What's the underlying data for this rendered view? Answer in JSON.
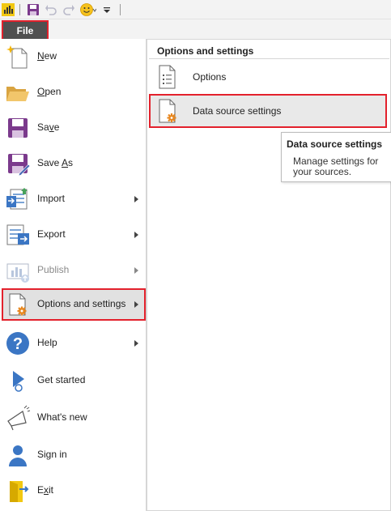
{
  "colors": {
    "highlight": "#e3212c",
    "file_tab": "#505050",
    "accent_orange": "#e8871e",
    "accent_purple": "#7b3a8c"
  },
  "toolbar": {
    "icons": [
      "power-bi-logo-icon",
      "save-icon",
      "undo-icon",
      "redo-icon",
      "smiley-feedback-icon",
      "customize-toolbar-icon"
    ]
  },
  "file_tab": {
    "label": "File"
  },
  "menu": {
    "items": [
      {
        "id": "new",
        "pre": "",
        "key": "N",
        "post": "ew",
        "icon": "new-file-icon",
        "has_submenu": false
      },
      {
        "id": "open",
        "pre": "",
        "key": "O",
        "post": "pen",
        "icon": "folder-open-icon",
        "has_submenu": false
      },
      {
        "id": "save",
        "pre": "Sa",
        "key": "v",
        "post": "e",
        "icon": "save-icon",
        "has_submenu": false
      },
      {
        "id": "save-as",
        "pre": "Save ",
        "key": "A",
        "post": "s",
        "icon": "save-as-icon",
        "has_submenu": false
      },
      {
        "id": "import",
        "label": "Import",
        "icon": "import-icon",
        "has_submenu": true
      },
      {
        "id": "export",
        "label": "Export",
        "icon": "export-icon",
        "has_submenu": true
      },
      {
        "id": "publish",
        "label": "Publish",
        "icon": "publish-icon",
        "has_submenu": true,
        "disabled": true
      },
      {
        "id": "options",
        "label": "Options and settings",
        "icon": "options-settings-icon",
        "has_submenu": true,
        "selected": true
      },
      {
        "id": "help",
        "label": "Help",
        "icon": "help-icon",
        "has_submenu": true
      },
      {
        "id": "get-started",
        "label": "Get started",
        "icon": "get-started-icon",
        "has_submenu": false
      },
      {
        "id": "whats-new",
        "label": "What's new",
        "icon": "megaphone-icon",
        "has_submenu": false
      },
      {
        "id": "sign-in",
        "label": "Sign in",
        "icon": "user-icon",
        "has_submenu": false
      },
      {
        "id": "exit",
        "pre": "E",
        "key": "x",
        "post": "it",
        "icon": "exit-icon",
        "has_submenu": false
      }
    ]
  },
  "panel": {
    "title": "Options and settings",
    "items": [
      {
        "id": "options",
        "label": "Options",
        "icon": "options-page-icon"
      },
      {
        "id": "data-source",
        "label": "Data source settings",
        "icon": "data-source-settings-icon",
        "selected": true
      }
    ]
  },
  "tooltip": {
    "title": "Data source settings",
    "body": "Manage settings for your sources."
  }
}
